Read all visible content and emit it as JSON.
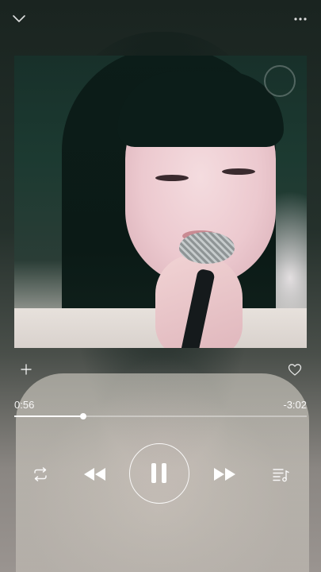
{
  "player": {
    "elapsed": "0:56",
    "remaining": "-3:02",
    "progress_fraction": 0.235,
    "state": "playing"
  },
  "icons": {
    "collapse": "chevron-down-icon",
    "more": "more-horizontal-icon",
    "add": "plus-icon",
    "like": "heart-outline-icon",
    "repeat": "repeat-icon",
    "previous": "rewind-icon",
    "pause": "pause-icon",
    "next": "fast-forward-icon",
    "queue": "playlist-icon"
  },
  "colors": {
    "foreground": "#ffffff",
    "background_dark": "#1d2621"
  }
}
